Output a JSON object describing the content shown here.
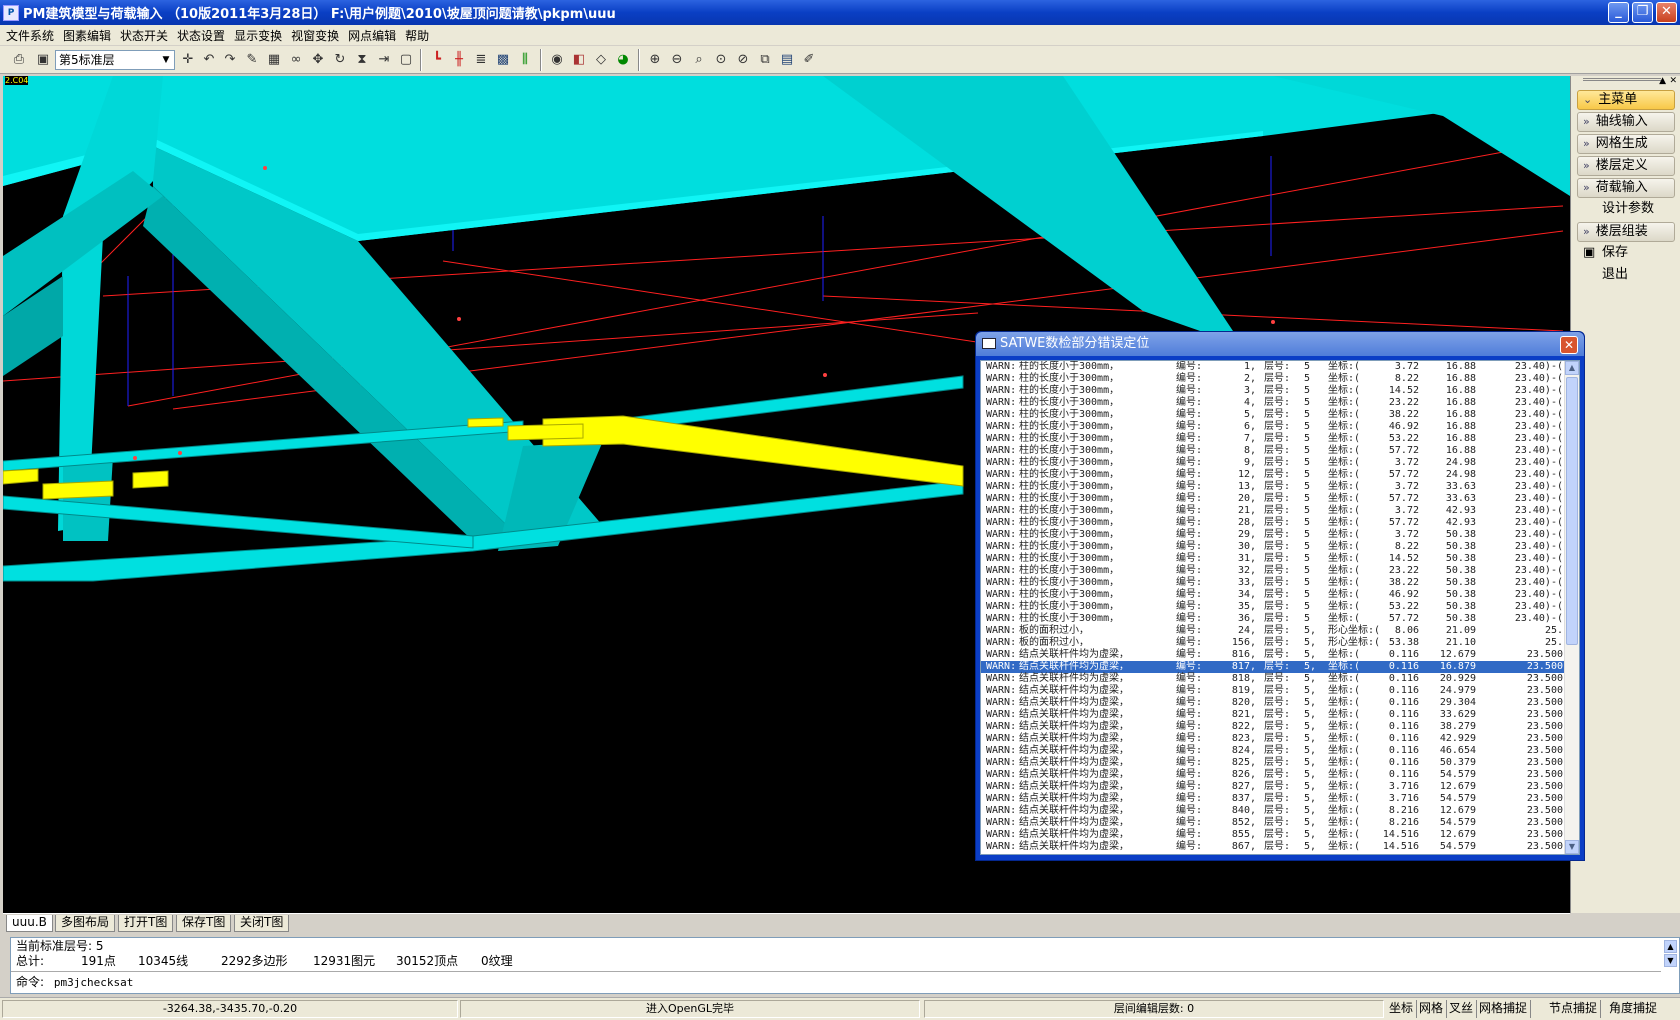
{
  "window": {
    "title": "PM建筑模型与荷载输入 （10版2011年3月28日）  F:\\用户例题\\2010\\坡屋顶问题请教\\pkpm\\uuu",
    "app_icon": "pkpm-app-icon",
    "minimize": "_",
    "restore": "❐",
    "close": "✕"
  },
  "menu": [
    "文件系统",
    "图素编辑",
    "状态开关",
    "状态设置",
    "显示变换",
    "视窗变换",
    "网点编辑",
    "帮助"
  ],
  "toolbar": {
    "floor_select": "第5标准层"
  },
  "viewport": {
    "corner_label": "2.C04"
  },
  "right_panel": {
    "items": [
      {
        "label": "主菜单",
        "chevron": "»",
        "selected": true
      },
      {
        "label": "轴线输入",
        "chevron": "»"
      },
      {
        "label": "网格生成",
        "chevron": "»"
      },
      {
        "label": "楼层定义",
        "chevron": "»"
      },
      {
        "label": "荷载输入",
        "chevron": "»"
      },
      {
        "label": "设计参数",
        "plain": true
      },
      {
        "label": "楼层组装",
        "chevron": "»"
      },
      {
        "label": "保存",
        "plain": true,
        "icon": "save-icon"
      },
      {
        "label": "退出",
        "plain": true
      }
    ]
  },
  "dialog": {
    "title": "SATWE数检部分错误定位",
    "close": "✕",
    "rows": [
      [
        "WARN:",
        "柱的长度小于300mm，",
        "编号:",
        "1,",
        "层号:",
        "5",
        "坐标:(",
        "3.72",
        "16.88",
        "23.40)-("
      ],
      [
        "WARN:",
        "柱的长度小于300mm，",
        "编号:",
        "2,",
        "层号:",
        "5",
        "坐标:(",
        "8.22",
        "16.88",
        "23.40)-("
      ],
      [
        "WARN:",
        "柱的长度小于300mm，",
        "编号:",
        "3,",
        "层号:",
        "5",
        "坐标:(",
        "14.52",
        "16.88",
        "23.40)-("
      ],
      [
        "WARN:",
        "柱的长度小于300mm，",
        "编号:",
        "4,",
        "层号:",
        "5",
        "坐标:(",
        "23.22",
        "16.88",
        "23.40)-("
      ],
      [
        "WARN:",
        "柱的长度小于300mm，",
        "编号:",
        "5,",
        "层号:",
        "5",
        "坐标:(",
        "38.22",
        "16.88",
        "23.40)-("
      ],
      [
        "WARN:",
        "柱的长度小于300mm，",
        "编号:",
        "6,",
        "层号:",
        "5",
        "坐标:(",
        "46.92",
        "16.88",
        "23.40)-("
      ],
      [
        "WARN:",
        "柱的长度小于300mm，",
        "编号:",
        "7,",
        "层号:",
        "5",
        "坐标:(",
        "53.22",
        "16.88",
        "23.40)-("
      ],
      [
        "WARN:",
        "柱的长度小于300mm，",
        "编号:",
        "8,",
        "层号:",
        "5",
        "坐标:(",
        "57.72",
        "16.88",
        "23.40)-("
      ],
      [
        "WARN:",
        "柱的长度小于300mm，",
        "编号:",
        "9,",
        "层号:",
        "5",
        "坐标:(",
        "3.72",
        "24.98",
        "23.40)-("
      ],
      [
        "WARN:",
        "柱的长度小于300mm，",
        "编号:",
        "12,",
        "层号:",
        "5",
        "坐标:(",
        "57.72",
        "24.98",
        "23.40)-("
      ],
      [
        "WARN:",
        "柱的长度小于300mm，",
        "编号:",
        "13,",
        "层号:",
        "5",
        "坐标:(",
        "3.72",
        "33.63",
        "23.40)-("
      ],
      [
        "WARN:",
        "柱的长度小于300mm，",
        "编号:",
        "20,",
        "层号:",
        "5",
        "坐标:(",
        "57.72",
        "33.63",
        "23.40)-("
      ],
      [
        "WARN:",
        "柱的长度小于300mm，",
        "编号:",
        "21,",
        "层号:",
        "5",
        "坐标:(",
        "3.72",
        "42.93",
        "23.40)-("
      ],
      [
        "WARN:",
        "柱的长度小于300mm，",
        "编号:",
        "28,",
        "层号:",
        "5",
        "坐标:(",
        "57.72",
        "42.93",
        "23.40)-("
      ],
      [
        "WARN:",
        "柱的长度小于300mm，",
        "编号:",
        "29,",
        "层号:",
        "5",
        "坐标:(",
        "3.72",
        "50.38",
        "23.40)-("
      ],
      [
        "WARN:",
        "柱的长度小于300mm，",
        "编号:",
        "30,",
        "层号:",
        "5",
        "坐标:(",
        "8.22",
        "50.38",
        "23.40)-("
      ],
      [
        "WARN:",
        "柱的长度小于300mm，",
        "编号:",
        "31,",
        "层号:",
        "5",
        "坐标:(",
        "14.52",
        "50.38",
        "23.40)-("
      ],
      [
        "WARN:",
        "柱的长度小于300mm，",
        "编号:",
        "32,",
        "层号:",
        "5",
        "坐标:(",
        "23.22",
        "50.38",
        "23.40)-("
      ],
      [
        "WARN:",
        "柱的长度小于300mm，",
        "编号:",
        "33,",
        "层号:",
        "5",
        "坐标:(",
        "38.22",
        "50.38",
        "23.40)-("
      ],
      [
        "WARN:",
        "柱的长度小于300mm，",
        "编号:",
        "34,",
        "层号:",
        "5",
        "坐标:(",
        "46.92",
        "50.38",
        "23.40)-("
      ],
      [
        "WARN:",
        "柱的长度小于300mm，",
        "编号:",
        "35,",
        "层号:",
        "5",
        "坐标:(",
        "53.22",
        "50.38",
        "23.40)-("
      ],
      [
        "WARN:",
        "柱的长度小于300mm，",
        "编号:",
        "36,",
        "层号:",
        "5",
        "坐标:(",
        "57.72",
        "50.38",
        "23.40)-("
      ],
      [
        "WARN:",
        "板的面积过小，",
        "编号:",
        "24,",
        "层号:",
        "5,",
        "形心坐标:(",
        "8.06",
        "21.09",
        "25."
      ],
      [
        "WARN:",
        "板的面积过小，",
        "编号:",
        "156,",
        "层号:",
        "5,",
        "形心坐标:(",
        "53.38",
        "21.10",
        "25."
      ],
      [
        "WARN:",
        "结点关联杆件均为虚梁，",
        "编号:",
        "816,",
        "层号:",
        "5,",
        "坐标:(",
        "0.116",
        "12.679",
        "23.500"
      ],
      [
        "WARN:",
        "结点关联杆件均为虚梁，",
        "编号:",
        "817,",
        "层号:",
        "5,",
        "坐标:(",
        "0.116",
        "16.879",
        "23.500"
      ],
      [
        "WARN:",
        "结点关联杆件均为虚梁，",
        "编号:",
        "818,",
        "层号:",
        "5,",
        "坐标:(",
        "0.116",
        "20.929",
        "23.500"
      ],
      [
        "WARN:",
        "结点关联杆件均为虚梁，",
        "编号:",
        "819,",
        "层号:",
        "5,",
        "坐标:(",
        "0.116",
        "24.979",
        "23.500"
      ],
      [
        "WARN:",
        "结点关联杆件均为虚梁，",
        "编号:",
        "820,",
        "层号:",
        "5,",
        "坐标:(",
        "0.116",
        "29.304",
        "23.500"
      ],
      [
        "WARN:",
        "结点关联杆件均为虚梁，",
        "编号:",
        "821,",
        "层号:",
        "5,",
        "坐标:(",
        "0.116",
        "33.629",
        "23.500"
      ],
      [
        "WARN:",
        "结点关联杆件均为虚梁，",
        "编号:",
        "822,",
        "层号:",
        "5,",
        "坐标:(",
        "0.116",
        "38.279",
        "23.500"
      ],
      [
        "WARN:",
        "结点关联杆件均为虚梁，",
        "编号:",
        "823,",
        "层号:",
        "5,",
        "坐标:(",
        "0.116",
        "42.929",
        "23.500"
      ],
      [
        "WARN:",
        "结点关联杆件均为虚梁，",
        "编号:",
        "824,",
        "层号:",
        "5,",
        "坐标:(",
        "0.116",
        "46.654",
        "23.500"
      ],
      [
        "WARN:",
        "结点关联杆件均为虚梁，",
        "编号:",
        "825,",
        "层号:",
        "5,",
        "坐标:(",
        "0.116",
        "50.379",
        "23.500"
      ],
      [
        "WARN:",
        "结点关联杆件均为虚梁，",
        "编号:",
        "826,",
        "层号:",
        "5,",
        "坐标:(",
        "0.116",
        "54.579",
        "23.500"
      ],
      [
        "WARN:",
        "结点关联杆件均为虚梁，",
        "编号:",
        "827,",
        "层号:",
        "5,",
        "坐标:(",
        "3.716",
        "12.679",
        "23.500"
      ],
      [
        "WARN:",
        "结点关联杆件均为虚梁，",
        "编号:",
        "837,",
        "层号:",
        "5,",
        "坐标:(",
        "3.716",
        "54.579",
        "23.500"
      ],
      [
        "WARN:",
        "结点关联杆件均为虚梁，",
        "编号:",
        "840,",
        "层号:",
        "5,",
        "坐标:(",
        "8.216",
        "12.679",
        "23.500"
      ],
      [
        "WARN:",
        "结点关联杆件均为虚梁，",
        "编号:",
        "852,",
        "层号:",
        "5,",
        "坐标:(",
        "8.216",
        "54.579",
        "23.500"
      ],
      [
        "WARN:",
        "结点关联杆件均为虚梁，",
        "编号:",
        "855,",
        "层号:",
        "5,",
        "坐标:(",
        "14.516",
        "12.679",
        "23.500"
      ],
      [
        "WARN:",
        "结点关联杆件均为虚梁，",
        "编号:",
        "867,",
        "层号:",
        "5,",
        "坐标:(",
        "14.516",
        "54.579",
        "23.500"
      ]
    ],
    "selected_row": 25
  },
  "tabs": [
    "uuu.B",
    "多图布局",
    "打开T图",
    "保存T图",
    "关闭T图"
  ],
  "command": {
    "line1": "当前标准层号:  5",
    "line2_label": "总计:",
    "stats": [
      "191点",
      "10345线",
      "2292多边形",
      "12931图元",
      "30152顶点",
      "0纹理"
    ],
    "prompt": "命令:",
    "input_value": "pm3jchecksat"
  },
  "status": {
    "coords": "-3264.38,-3435.70,-0.20",
    "message": "进入OpenGL完毕",
    "floors": "层间编辑层数:   0",
    "buttons": [
      "坐标",
      "网格",
      "叉丝",
      "网格捕捉",
      "节点捕捉",
      "角度捕捉"
    ]
  },
  "colors": {
    "beam": "#00e5e5",
    "selected": "#ffff00",
    "grid": "#ff0000",
    "column_line": "#0000ff",
    "title_blue": "#0a3fc4"
  }
}
